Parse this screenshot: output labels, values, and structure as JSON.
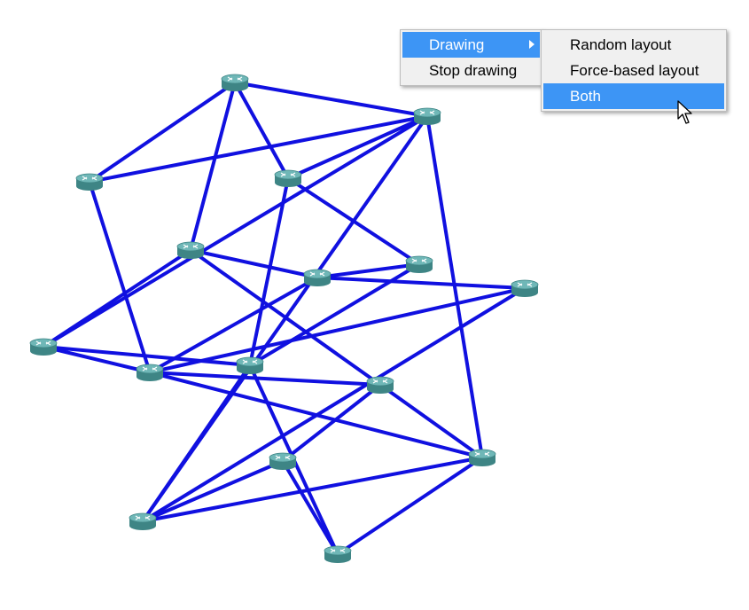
{
  "topology": {
    "link_color": "#1010e0",
    "router_color": "#4a9b9b",
    "router_icon": "router-icon",
    "routers": [
      {
        "id": "r1"
      },
      {
        "id": "r2"
      },
      {
        "id": "r3"
      },
      {
        "id": "r4"
      },
      {
        "id": "r5"
      },
      {
        "id": "r6"
      },
      {
        "id": "r7"
      },
      {
        "id": "r8"
      },
      {
        "id": "r9"
      },
      {
        "id": "r10"
      },
      {
        "id": "r11"
      },
      {
        "id": "r12"
      },
      {
        "id": "r13"
      },
      {
        "id": "r14"
      },
      {
        "id": "r15"
      },
      {
        "id": "r16"
      }
    ],
    "links": [
      [
        "r1",
        "r2"
      ],
      [
        "r1",
        "r3"
      ],
      [
        "r1",
        "r4"
      ],
      [
        "r1",
        "r5"
      ],
      [
        "r2",
        "r4"
      ],
      [
        "r2",
        "r10"
      ],
      [
        "r3",
        "r4"
      ],
      [
        "r3",
        "r7"
      ],
      [
        "r3",
        "r11"
      ],
      [
        "r4",
        "r9"
      ],
      [
        "r4",
        "r14"
      ],
      [
        "r4",
        "r15"
      ],
      [
        "r5",
        "r6"
      ],
      [
        "r5",
        "r9"
      ],
      [
        "r5",
        "r12"
      ],
      [
        "r6",
        "r8"
      ],
      [
        "r6",
        "r7"
      ],
      [
        "r6",
        "r10"
      ],
      [
        "r7",
        "r11"
      ],
      [
        "r8",
        "r10"
      ],
      [
        "r8",
        "r15"
      ],
      [
        "r9",
        "r10"
      ],
      [
        "r9",
        "r11"
      ],
      [
        "r10",
        "r12"
      ],
      [
        "r10",
        "r14"
      ],
      [
        "r11",
        "r15"
      ],
      [
        "r11",
        "r16"
      ],
      [
        "r12",
        "r13"
      ],
      [
        "r12",
        "r14"
      ],
      [
        "r13",
        "r15"
      ],
      [
        "r13",
        "r16"
      ],
      [
        "r14",
        "r15"
      ],
      [
        "r14",
        "r16"
      ]
    ]
  },
  "context_menu": {
    "items": [
      {
        "label": "Drawing",
        "has_submenu": true,
        "highlighted": true
      },
      {
        "label": "Stop drawing",
        "has_submenu": false,
        "highlighted": false
      }
    ]
  },
  "submenu": {
    "items": [
      {
        "label": "Random layout",
        "highlighted": false
      },
      {
        "label": "Force-based layout",
        "highlighted": false
      },
      {
        "label": "Both",
        "highlighted": true
      }
    ]
  },
  "colors": {
    "menu_highlight": "#3d95f5",
    "menu_background": "#f0f0f0"
  },
  "cursor": {
    "icon": "arrow-cursor-icon"
  }
}
